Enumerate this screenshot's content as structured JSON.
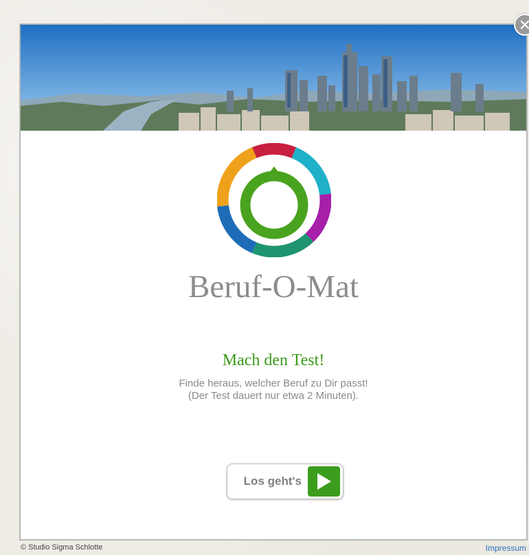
{
  "app": {
    "title": "Beruf-O-Mat"
  },
  "intro": {
    "heading": "Mach den Test!",
    "line1": "Finde heraus, welcher Beruf zu Dir passt!",
    "line2": "(Der Test dauert nur etwa 2 Minuten)."
  },
  "start_button": {
    "label": "Los geht's",
    "icon": "play-icon"
  },
  "close_button": {
    "label": "✕",
    "icon": "close-icon"
  },
  "footer": {
    "copyright": "© Studio Sigma Schlotte",
    "impressum": "Impressum"
  },
  "colors": {
    "accent_green": "#3c9d1d",
    "title_gray": "#8c8c8c",
    "link_blue": "#2a6fbf",
    "logo_segments": [
      "#c8203f",
      "#1fb1c9",
      "#a71ea9",
      "#1e9470",
      "#1e6cb8",
      "#f0a11b"
    ]
  },
  "banner": {
    "image": "frankfurt-skyline-photo"
  }
}
